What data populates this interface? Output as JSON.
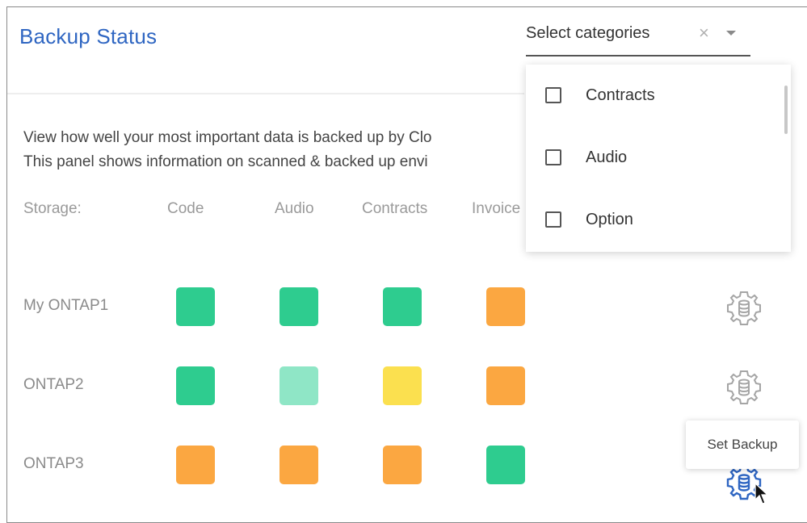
{
  "panel": {
    "title": "Backup Status",
    "description_lines": [
      "View how well your most important data is backed up by Clo",
      "This panel shows information on scanned & backed up envi"
    ]
  },
  "category_select": {
    "placeholder": "Select categories",
    "clear_icon": "close-icon",
    "caret_icon": "chevron-down-icon",
    "options": [
      {
        "label": "Contracts",
        "checked": false
      },
      {
        "label": "Audio",
        "checked": false
      },
      {
        "label": "Option",
        "checked": false
      }
    ]
  },
  "table": {
    "header": {
      "storage": "Storage:",
      "columns": [
        "Code",
        "Audio",
        "Contracts",
        "Invoice"
      ]
    },
    "rows": [
      {
        "name": "My ONTAP1",
        "statuses": [
          "green",
          "green",
          "green",
          "orange"
        ]
      },
      {
        "name": "ONTAP2",
        "statuses": [
          "green",
          "light-green",
          "yellow",
          "orange"
        ]
      },
      {
        "name": "ONTAP3",
        "statuses": [
          "orange",
          "orange",
          "orange",
          "green"
        ]
      }
    ]
  },
  "status_colors": {
    "green": "#2ecc8f",
    "light-green": "#8fe6c6",
    "yellow": "#fbe04f",
    "orange": "#fba741"
  },
  "action": {
    "icon": "gear-database-icon",
    "tooltip": "Set Backup",
    "gear_color": "#a5a5a5",
    "gear_active_color": "#2f66c2"
  }
}
